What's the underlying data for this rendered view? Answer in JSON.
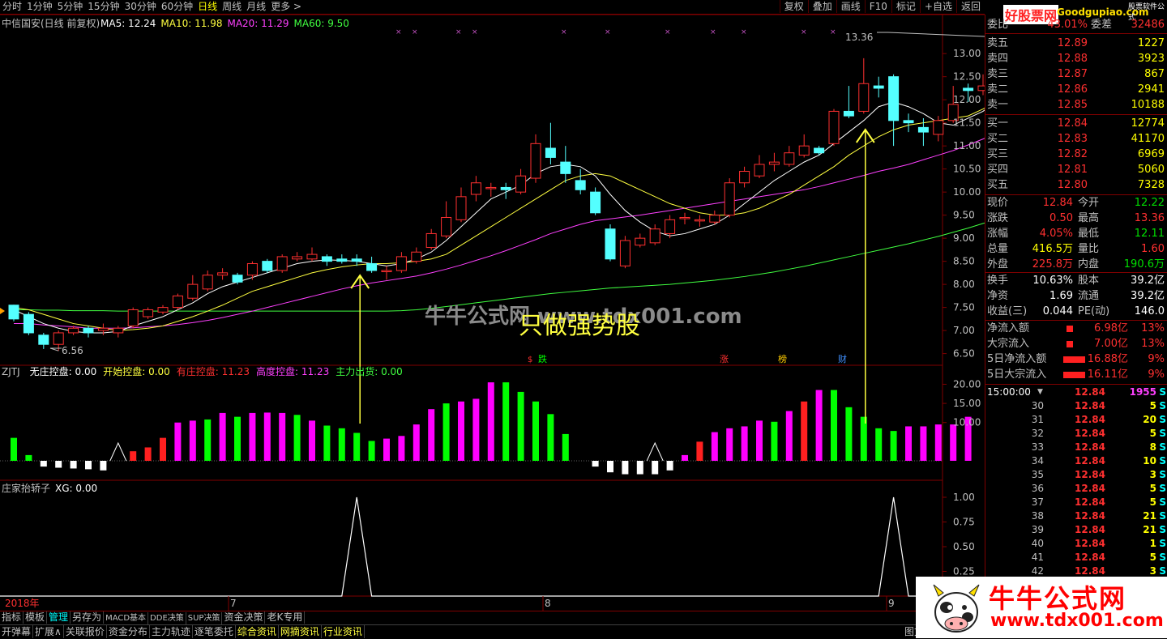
{
  "topbar": {
    "periods": [
      "分时",
      "1分钟",
      "5分钟",
      "15分钟",
      "30分钟",
      "60分钟",
      "日线",
      "周线",
      "月线",
      "更多 >"
    ],
    "active_period": "日线",
    "right_buttons": [
      "复权",
      "叠加",
      "画线",
      "F10",
      "标记",
      "+自选",
      "返回"
    ]
  },
  "logo": {
    "brand": "好股票网",
    "domain": "Goodgupiao.com",
    "sub": "股票软件公式"
  },
  "header_title": "中信国安(日线 前复权)",
  "ma_legend": [
    {
      "text": "MA5: 12.24",
      "color": "#ffffff"
    },
    {
      "text": "MA10: 11.98",
      "color": "#ffff40"
    },
    {
      "text": "MA20: 11.29",
      "color": "#ff40ff"
    },
    {
      "text": "MA60: 9.50",
      "color": "#40ff40"
    }
  ],
  "price_axis": [
    "13.00",
    "12.50",
    "12.00",
    "11.50",
    "11.00",
    "10.50",
    "10.00",
    "9.50",
    "9.00",
    "8.50",
    "8.00",
    "7.50",
    "7.00",
    "6.50"
  ],
  "high_marker": "13.36",
  "low_marker": "6.56",
  "watermark_text": "牛牛公式网 www.tdx001.com",
  "slogan": "只做强势股",
  "event_markers": [
    {
      "text": "跌",
      "color": "#00ff00"
    },
    {
      "text": "涨",
      "color": "#ff3030"
    },
    {
      "text": "榜",
      "color": "#ffcc00"
    },
    {
      "text": "财",
      "color": "#4090ff"
    },
    {
      "text": "$",
      "color": "#ff3030"
    }
  ],
  "indicator1": {
    "name": "ZJTJ",
    "items": [
      {
        "text": "无庄控盘: 0.00",
        "color": "#ffffff"
      },
      {
        "text": "开始控盘: 0.00",
        "color": "#ffff40"
      },
      {
        "text": "有庄控盘: 11.23",
        "color": "#ff3030"
      },
      {
        "text": "高度控盘: 11.23",
        "color": "#ff40ff"
      },
      {
        "text": "主力出货: 0.00",
        "color": "#40ff40"
      }
    ],
    "axis": [
      "20.00",
      "15.00",
      "10.00"
    ]
  },
  "indicator2": {
    "name": "庄家抬轿子",
    "value": "XG: 0.00",
    "axis": [
      "1.00",
      "0.75",
      "0.50",
      "0.25"
    ]
  },
  "date_axis": [
    "2018年",
    "7",
    "8",
    "9"
  ],
  "quote": {
    "weibi_label": "委比",
    "weibi_value": "43.01%",
    "weicha_label": "委差",
    "weicha_value": "32486",
    "asks": [
      {
        "label": "卖五",
        "price": "12.89",
        "vol": "1227"
      },
      {
        "label": "卖四",
        "price": "12.88",
        "vol": "3923"
      },
      {
        "label": "卖三",
        "price": "12.87",
        "vol": "867"
      },
      {
        "label": "卖二",
        "price": "12.86",
        "vol": "2941"
      },
      {
        "label": "卖一",
        "price": "12.85",
        "vol": "10188"
      }
    ],
    "bids": [
      {
        "label": "买一",
        "price": "12.84",
        "vol": "12774"
      },
      {
        "label": "买二",
        "price": "12.83",
        "vol": "41170"
      },
      {
        "label": "买三",
        "price": "12.82",
        "vol": "6969"
      },
      {
        "label": "买四",
        "price": "12.81",
        "vol": "5060"
      },
      {
        "label": "买五",
        "price": "12.80",
        "vol": "7328"
      }
    ],
    "stats": [
      {
        "l1": "现价",
        "v1": "12.84",
        "c1": "red",
        "l2": "今开",
        "v2": "12.22",
        "c2": "grn"
      },
      {
        "l1": "涨跌",
        "v1": "0.50",
        "c1": "red",
        "l2": "最高",
        "v2": "13.36",
        "c2": "red"
      },
      {
        "l1": "涨幅",
        "v1": "4.05%",
        "c1": "red",
        "l2": "最低",
        "v2": "12.11",
        "c2": "grn"
      },
      {
        "l1": "总量",
        "v1": "416.5万",
        "c1": "yel",
        "l2": "量比",
        "v2": "1.60",
        "c2": "red"
      },
      {
        "l1": "外盘",
        "v1": "225.8万",
        "c1": "red",
        "l2": "内盘",
        "v2": "190.6万",
        "c2": "grn"
      }
    ],
    "stats2": [
      {
        "l1": "换手",
        "v1": "10.63%",
        "l2": "股本",
        "v2": "39.2亿"
      },
      {
        "l1": "净资",
        "v1": "1.69",
        "l2": "流通",
        "v2": "39.2亿"
      },
      {
        "l1": "收益(三)",
        "v1": "0.044",
        "l2": "PE(动)",
        "v2": "146.0"
      }
    ],
    "flows": [
      {
        "label": "净流入额",
        "value": "6.98亿",
        "pct": "13%",
        "bar": 0.18
      },
      {
        "label": "大宗流入",
        "value": "7.00亿",
        "pct": "13%",
        "bar": 0.18
      },
      {
        "label": "5日净流入额",
        "value": "16.88亿",
        "pct": "9%",
        "bar": 0.45
      },
      {
        "label": "5日大宗流入",
        "value": "16.11亿",
        "pct": "9%",
        "bar": 0.45
      }
    ],
    "tick_header": {
      "time": "15:00:00",
      "price": "12.84",
      "vol": "1955",
      "side": "S"
    },
    "ticks": [
      {
        "t": "30",
        "p": "12.84",
        "v": "5",
        "s": "S"
      },
      {
        "t": "31",
        "p": "12.84",
        "v": "20",
        "s": "S"
      },
      {
        "t": "32",
        "p": "12.84",
        "v": "5",
        "s": "S"
      },
      {
        "t": "33",
        "p": "12.84",
        "v": "8",
        "s": "S"
      },
      {
        "t": "34",
        "p": "12.84",
        "v": "10",
        "s": "S"
      },
      {
        "t": "35",
        "p": "12.84",
        "v": "3",
        "s": "S"
      },
      {
        "t": "36",
        "p": "12.84",
        "v": "5",
        "s": "S"
      },
      {
        "t": "37",
        "p": "12.84",
        "v": "5",
        "s": "S"
      },
      {
        "t": "38",
        "p": "12.84",
        "v": "21",
        "s": "S"
      },
      {
        "t": "39",
        "p": "12.84",
        "v": "21",
        "s": "S"
      },
      {
        "t": "40",
        "p": "12.84",
        "v": "1",
        "s": "S"
      },
      {
        "t": "41",
        "p": "12.84",
        "v": "5",
        "s": "S"
      },
      {
        "t": "42",
        "p": "12.84",
        "v": "3",
        "s": "S"
      }
    ]
  },
  "bottom_tabs": [
    "指标",
    "模板",
    "管理",
    "另存为",
    "MACD基本",
    "DDE决策",
    "SUP决策",
    "资金决策",
    "老K专用"
  ],
  "status_tabs": [
    "开弹幕",
    "扩展∧",
    "关联报价",
    "资金分布",
    "主力轨迹",
    "逐笔委托",
    "综合资讯",
    "网摘资讯",
    "行业资讯"
  ],
  "status_right": "图文F10",
  "brand_watermark": {
    "cn": "牛牛公式网",
    "url": "www.tdx001.com"
  },
  "chart_data": {
    "type": "candlestick",
    "title": "中信国安(日线 前复权)",
    "ylim": [
      6.3,
      13.6
    ],
    "candles": [
      [
        7.55,
        7.25,
        7.56,
        7.2
      ],
      [
        7.35,
        6.95,
        7.4,
        6.9
      ],
      [
        6.9,
        6.7,
        6.95,
        6.6
      ],
      [
        6.7,
        6.95,
        7.0,
        6.56
      ],
      [
        6.95,
        7.05,
        7.1,
        6.9
      ],
      [
        7.05,
        6.95,
        7.1,
        6.85
      ],
      [
        7.0,
        7.05,
        7.15,
        6.9
      ],
      [
        6.95,
        7.05,
        7.1,
        6.85
      ],
      [
        7.1,
        7.45,
        7.5,
        7.05
      ],
      [
        7.3,
        7.45,
        7.5,
        7.25
      ],
      [
        7.4,
        7.5,
        7.55,
        7.35
      ],
      [
        7.5,
        7.75,
        7.8,
        7.45
      ],
      [
        7.7,
        8.0,
        8.2,
        7.65
      ],
      [
        7.9,
        8.2,
        8.3,
        7.85
      ],
      [
        8.2,
        8.25,
        8.35,
        8.1
      ],
      [
        8.2,
        8.05,
        8.25,
        8.0
      ],
      [
        8.2,
        8.45,
        8.5,
        8.1
      ],
      [
        8.5,
        8.3,
        8.55,
        8.25
      ],
      [
        8.3,
        8.6,
        8.65,
        8.25
      ],
      [
        8.55,
        8.6,
        8.7,
        8.5
      ],
      [
        8.55,
        8.65,
        8.8,
        8.5
      ],
      [
        8.6,
        8.5,
        8.65,
        8.4
      ],
      [
        8.55,
        8.5,
        8.65,
        8.45
      ],
      [
        8.55,
        8.5,
        8.65,
        8.4
      ],
      [
        8.45,
        8.3,
        8.6,
        8.25
      ],
      [
        8.3,
        8.3,
        8.4,
        8.1
      ],
      [
        8.3,
        8.6,
        8.7,
        8.25
      ],
      [
        8.5,
        8.7,
        8.8,
        8.45
      ],
      [
        8.8,
        9.1,
        9.2,
        8.75
      ],
      [
        9.05,
        9.45,
        9.8,
        9.0
      ],
      [
        9.4,
        9.9,
        10.1,
        9.35
      ],
      [
        9.95,
        10.2,
        10.35,
        9.8
      ],
      [
        10.1,
        10.1,
        10.2,
        9.9
      ],
      [
        10.1,
        10.05,
        10.2,
        9.85
      ],
      [
        10.0,
        10.35,
        10.5,
        9.95
      ],
      [
        10.3,
        11.05,
        11.25,
        10.2
      ],
      [
        10.95,
        10.75,
        11.5,
        10.6
      ],
      [
        10.65,
        10.4,
        11.0,
        10.2
      ],
      [
        10.25,
        10.05,
        10.5,
        9.95
      ],
      [
        10.0,
        9.55,
        10.1,
        9.5
      ],
      [
        9.2,
        8.55,
        9.3,
        8.5
      ],
      [
        8.4,
        8.95,
        9.05,
        8.35
      ],
      [
        8.85,
        9.0,
        9.1,
        8.8
      ],
      [
        8.9,
        9.2,
        9.3,
        8.85
      ],
      [
        9.1,
        9.4,
        9.5,
        9.0
      ],
      [
        9.45,
        9.45,
        9.55,
        9.3
      ],
      [
        9.4,
        9.4,
        9.5,
        9.25
      ],
      [
        9.35,
        9.5,
        9.6,
        9.3
      ],
      [
        9.5,
        10.2,
        10.3,
        9.45
      ],
      [
        10.2,
        10.45,
        10.55,
        10.1
      ],
      [
        10.35,
        10.6,
        10.8,
        10.3
      ],
      [
        10.6,
        10.65,
        10.85,
        10.45
      ],
      [
        10.6,
        10.85,
        11.0,
        10.55
      ],
      [
        10.8,
        11.0,
        11.25,
        10.75
      ],
      [
        10.95,
        10.85,
        11.0,
        10.8
      ],
      [
        11.05,
        11.75,
        11.8,
        11.0
      ],
      [
        11.75,
        11.65,
        12.3,
        11.6
      ],
      [
        11.75,
        12.35,
        12.9,
        11.7
      ],
      [
        12.3,
        12.25,
        12.5,
        12.05
      ],
      [
        12.5,
        11.55,
        12.55,
        11.0
      ],
      [
        11.55,
        11.5,
        11.7,
        11.3
      ],
      [
        11.4,
        11.3,
        11.6,
        11.0
      ],
      [
        11.25,
        11.55,
        11.65,
        11.1
      ],
      [
        11.55,
        11.9,
        12.3,
        11.5
      ],
      [
        12.25,
        12.2,
        12.35,
        11.95
      ],
      [
        12.2,
        12.3,
        12.55,
        12.1
      ],
      [
        12.25,
        12.84,
        13.36,
        12.11
      ]
    ],
    "ma5": [
      7.45,
      7.3,
      7.15,
      7.05,
      6.98,
      6.95,
      6.95,
      6.98,
      7.1,
      7.2,
      7.3,
      7.45,
      7.6,
      7.8,
      7.95,
      8.05,
      8.15,
      8.25,
      8.35,
      8.45,
      8.5,
      8.53,
      8.52,
      8.5,
      8.45,
      8.4,
      8.45,
      8.55,
      8.7,
      8.95,
      9.25,
      9.55,
      9.85,
      10.0,
      10.15,
      10.4,
      10.55,
      10.6,
      10.55,
      10.35,
      9.95,
      9.6,
      9.35,
      9.15,
      9.05,
      9.1,
      9.2,
      9.3,
      9.5,
      9.75,
      10.0,
      10.25,
      10.45,
      10.65,
      10.8,
      11.05,
      11.3,
      11.55,
      11.85,
      11.95,
      11.85,
      11.7,
      11.5,
      11.45,
      11.6,
      11.75,
      12.0
    ],
    "ma10": [
      7.5,
      7.45,
      7.35,
      7.25,
      7.15,
      7.1,
      7.05,
      7.0,
      7.02,
      7.05,
      7.1,
      7.2,
      7.3,
      7.42,
      7.55,
      7.7,
      7.85,
      7.95,
      8.05,
      8.15,
      8.25,
      8.32,
      8.38,
      8.42,
      8.45,
      8.45,
      8.47,
      8.5,
      8.55,
      8.65,
      8.85,
      9.05,
      9.25,
      9.45,
      9.65,
      9.85,
      10.05,
      10.25,
      10.35,
      10.4,
      10.35,
      10.2,
      10.05,
      9.9,
      9.75,
      9.65,
      9.55,
      9.5,
      9.5,
      9.55,
      9.65,
      9.8,
      9.95,
      10.15,
      10.35,
      10.55,
      10.8,
      11.0,
      11.2,
      11.35,
      11.45,
      11.5,
      11.55,
      11.6,
      11.65,
      11.8,
      11.98
    ],
    "ma20": [
      7.15,
      7.15,
      7.12,
      7.1,
      7.08,
      7.05,
      7.05,
      7.05,
      7.06,
      7.08,
      7.1,
      7.13,
      7.17,
      7.22,
      7.28,
      7.35,
      7.42,
      7.5,
      7.58,
      7.66,
      7.74,
      7.82,
      7.9,
      7.97,
      8.03,
      8.08,
      8.13,
      8.18,
      8.25,
      8.33,
      8.42,
      8.52,
      8.62,
      8.73,
      8.85,
      8.97,
      9.1,
      9.2,
      9.3,
      9.38,
      9.42,
      9.46,
      9.5,
      9.55,
      9.6,
      9.65,
      9.7,
      9.75,
      9.8,
      9.85,
      9.9,
      9.95,
      10.0,
      10.05,
      10.12,
      10.2,
      10.28,
      10.36,
      10.45,
      10.52,
      10.6,
      10.7,
      10.8,
      10.9,
      11.02,
      11.15,
      11.29
    ],
    "ma60": [
      7.45,
      7.45,
      7.44,
      7.44,
      7.43,
      7.43,
      7.43,
      7.42,
      7.42,
      7.42,
      7.42,
      7.42,
      7.42,
      7.42,
      7.42,
      7.42,
      7.42,
      7.42,
      7.42,
      7.42,
      7.42,
      7.42,
      7.42,
      7.42,
      7.42,
      7.42,
      7.43,
      7.45,
      7.48,
      7.52,
      7.56,
      7.6,
      7.64,
      7.68,
      7.72,
      7.76,
      7.8,
      7.83,
      7.86,
      7.89,
      7.92,
      7.94,
      7.96,
      7.98,
      8.0,
      8.03,
      8.06,
      8.09,
      8.13,
      8.17,
      8.22,
      8.27,
      8.33,
      8.39,
      8.46,
      8.53,
      8.6,
      8.67,
      8.74,
      8.81,
      8.88,
      8.96,
      9.04,
      9.13,
      9.22,
      9.32,
      9.42
    ],
    "ind1_bars": [
      {
        "v": 6,
        "c": "g"
      },
      {
        "v": 1.5,
        "c": "g"
      },
      {
        "v": -1.5,
        "c": "w"
      },
      {
        "v": -1.8,
        "c": "w"
      },
      {
        "v": -2,
        "c": "w"
      },
      {
        "v": -2.2,
        "c": "w"
      },
      {
        "v": -2.5,
        "c": "w"
      },
      {
        "v": 0,
        "c": "n"
      },
      {
        "v": 2.5,
        "c": "r"
      },
      {
        "v": 3.5,
        "c": "r"
      },
      {
        "v": 6,
        "c": "r"
      },
      {
        "v": 10,
        "c": "m"
      },
      {
        "v": 10.5,
        "c": "m"
      },
      {
        "v": 10.8,
        "c": "g"
      },
      {
        "v": 12.5,
        "c": "m"
      },
      {
        "v": 11.5,
        "c": "g"
      },
      {
        "v": 12.5,
        "c": "m"
      },
      {
        "v": 12.6,
        "c": "m"
      },
      {
        "v": 12.5,
        "c": "m"
      },
      {
        "v": 12.0,
        "c": "g"
      },
      {
        "v": 10.5,
        "c": "m"
      },
      {
        "v": 9.2,
        "c": "g"
      },
      {
        "v": 8.5,
        "c": "g"
      },
      {
        "v": 7.3,
        "c": "g"
      },
      {
        "v": 5.2,
        "c": "g"
      },
      {
        "v": 5.8,
        "c": "m"
      },
      {
        "v": 6.5,
        "c": "m"
      },
      {
        "v": 9.5,
        "c": "m"
      },
      {
        "v": 13.5,
        "c": "m"
      },
      {
        "v": 15.0,
        "c": "g"
      },
      {
        "v": 15.5,
        "c": "m"
      },
      {
        "v": 16.2,
        "c": "m"
      },
      {
        "v": 20.5,
        "c": "m"
      },
      {
        "v": 20.5,
        "c": "g"
      },
      {
        "v": 18.0,
        "c": "g"
      },
      {
        "v": 15.5,
        "c": "g"
      },
      {
        "v": 12.2,
        "c": "g"
      },
      {
        "v": 7.0,
        "c": "g"
      },
      {
        "v": 0,
        "c": "n"
      },
      {
        "v": -1.5,
        "c": "w"
      },
      {
        "v": -3,
        "c": "w"
      },
      {
        "v": -3.5,
        "c": "w"
      },
      {
        "v": -3.5,
        "c": "w"
      },
      {
        "v": -3.5,
        "c": "w"
      },
      {
        "v": -2.5,
        "c": "w"
      },
      {
        "v": 1.5,
        "c": "m"
      },
      {
        "v": 5.0,
        "c": "r"
      },
      {
        "v": 7.5,
        "c": "m"
      },
      {
        "v": 8.5,
        "c": "m"
      },
      {
        "v": 9.0,
        "c": "m"
      },
      {
        "v": 10.5,
        "c": "m"
      },
      {
        "v": 10.2,
        "c": "g"
      },
      {
        "v": 13.0,
        "c": "m"
      },
      {
        "v": 15.5,
        "c": "r"
      },
      {
        "v": 18.5,
        "c": "m"
      },
      {
        "v": 18.5,
        "c": "g"
      },
      {
        "v": 14.0,
        "c": "g"
      },
      {
        "v": 11.5,
        "c": "g"
      },
      {
        "v": 8.5,
        "c": "g"
      },
      {
        "v": 7.8,
        "c": "g"
      },
      {
        "v": 9.0,
        "c": "m"
      },
      {
        "v": 9.0,
        "c": "m"
      },
      {
        "v": 9.5,
        "c": "m"
      },
      {
        "v": 9.5,
        "c": "m"
      },
      {
        "v": 11.5,
        "c": "m"
      }
    ],
    "ind1_triangles": [
      7,
      43
    ],
    "ind1_ylim": [
      -5,
      22
    ],
    "ind2_signal": [
      0,
      0,
      0,
      0,
      0,
      0,
      0,
      0,
      0,
      0,
      0,
      0,
      0,
      0,
      0,
      0,
      0,
      0,
      0,
      0,
      0,
      0,
      0,
      1,
      0,
      0,
      0,
      0,
      0,
      0,
      0,
      0,
      0,
      0,
      0,
      0,
      0,
      0,
      0,
      0,
      0,
      0,
      0,
      0,
      0,
      0,
      0,
      0,
      0,
      0,
      0,
      0,
      0,
      0,
      0,
      0,
      0,
      0,
      0,
      1,
      0,
      0,
      0,
      0,
      0,
      0,
      0
    ],
    "ind2_ylim": [
      0,
      1.1
    ],
    "signal_arrows": [
      23,
      57
    ]
  }
}
